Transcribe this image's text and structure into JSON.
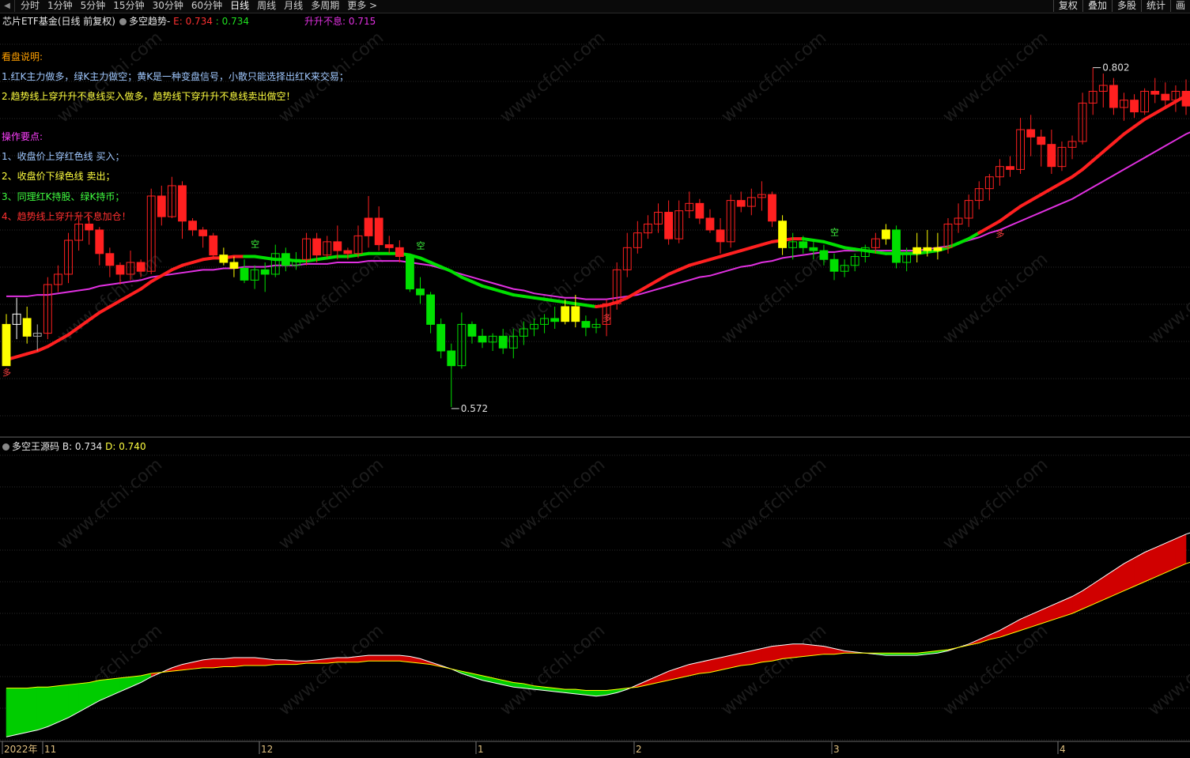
{
  "toolbar": {
    "periods": [
      "分时",
      "1分钟",
      "5分钟",
      "15分钟",
      "30分钟",
      "60分钟",
      "日线",
      "周线",
      "月线",
      "多周期",
      "更多 >"
    ],
    "active_period": "日线",
    "right_buttons": [
      "复权",
      "叠加",
      "多股",
      "统计",
      "画"
    ]
  },
  "main_panel": {
    "security": "芯片ETF基金(日线 前复权)",
    "indicator": "多空趋势-",
    "e_label": "E: 0.734",
    "e2_label": ": 0.734",
    "sheng_label": "升升不息: 0.715",
    "high_marker": "0.802",
    "low_marker": "0.572",
    "signal_duo": "多",
    "signal_kong": "空"
  },
  "notes": {
    "heading1": "看盘说明:",
    "line1": "1.红K主力做多，绿K主力做空；黄K是一种变盘信号，小散只能选择出红K来交易；",
    "line2": "2.趋势线上穿升升不息线买入做多，趋势线下穿升升不息线卖出做空！",
    "heading2": "操作要点:",
    "tip1": "1、收盘价上穿红色线 买入；",
    "tip2": "2、收盘价下绿色线 卖出；",
    "tip3": "3、同理红K持股、绿K持币；",
    "tip4": "4、趋势线上穿升升不息加仓！"
  },
  "sub_panel": {
    "name": "多空王源码",
    "b_label": "B: 0.734",
    "d_label": "D: 0.740"
  },
  "x_axis": {
    "labels": [
      "2022年",
      "11",
      "12",
      "1",
      "2",
      "3",
      "4"
    ]
  },
  "watermark": "www.cfchi.com",
  "colors": {
    "up": "#ff2020",
    "down": "#00e000",
    "yellow": "#ffff00",
    "trend_up": "#ff2020",
    "trend_down": "#00e000",
    "magenta": "#e030e0",
    "grid": "#333333",
    "background": "#000000"
  },
  "chart_data": {
    "type": "candlestick",
    "price_range": [
      0.55,
      0.82
    ],
    "osc_range": [
      0.5,
      1.0
    ],
    "candles": [
      [
        0.6,
        0.635,
        0.628,
        0.608,
        "y"
      ],
      [
        0.628,
        0.646,
        0.635,
        0.618,
        "w"
      ],
      [
        0.632,
        0.64,
        0.62,
        0.615,
        "y"
      ],
      [
        0.62,
        0.628,
        0.622,
        0.61,
        "n"
      ],
      [
        0.622,
        0.66,
        0.655,
        0.618,
        "u"
      ],
      [
        0.655,
        0.668,
        0.662,
        0.65,
        "u"
      ],
      [
        0.662,
        0.69,
        0.685,
        0.656,
        "u"
      ],
      [
        0.685,
        0.702,
        0.696,
        0.678,
        "u"
      ],
      [
        0.696,
        0.701,
        0.692,
        0.682,
        "d"
      ],
      [
        0.692,
        0.694,
        0.676,
        0.668,
        "r"
      ],
      [
        0.676,
        0.68,
        0.668,
        0.66,
        "r"
      ],
      [
        0.668,
        0.67,
        0.662,
        0.655,
        "d"
      ],
      [
        0.662,
        0.678,
        0.67,
        0.658,
        "u"
      ],
      [
        0.67,
        0.672,
        0.664,
        0.66,
        "d"
      ],
      [
        0.664,
        0.72,
        0.715,
        0.662,
        "u"
      ],
      [
        0.715,
        0.722,
        0.701,
        0.695,
        "r"
      ],
      [
        0.701,
        0.728,
        0.722,
        0.7,
        "u"
      ],
      [
        0.722,
        0.725,
        0.698,
        0.686,
        "r"
      ],
      [
        0.698,
        0.7,
        0.692,
        0.688,
        "r"
      ],
      [
        0.692,
        0.694,
        0.688,
        0.68,
        "r"
      ],
      [
        0.688,
        0.69,
        0.675,
        0.672,
        "r"
      ],
      [
        0.675,
        0.68,
        0.67,
        0.668,
        "y"
      ],
      [
        0.67,
        0.674,
        0.666,
        0.66,
        "y"
      ],
      [
        0.666,
        0.672,
        0.658,
        0.656,
        "g"
      ],
      [
        0.658,
        0.668,
        0.665,
        0.652,
        "gu"
      ],
      [
        0.665,
        0.67,
        0.662,
        0.65,
        "g"
      ],
      [
        0.662,
        0.682,
        0.676,
        0.66,
        "gu"
      ],
      [
        0.676,
        0.68,
        0.668,
        0.664,
        "g"
      ],
      [
        0.668,
        0.677,
        0.672,
        0.665,
        "gu"
      ],
      [
        0.672,
        0.69,
        0.686,
        0.668,
        "u"
      ],
      [
        0.686,
        0.69,
        0.675,
        0.67,
        "r"
      ],
      [
        0.675,
        0.688,
        0.684,
        0.673,
        "u"
      ],
      [
        0.684,
        0.695,
        0.678,
        0.672,
        "r"
      ],
      [
        0.678,
        0.68,
        0.676,
        0.672,
        "r"
      ],
      [
        0.676,
        0.695,
        0.688,
        0.673,
        "u"
      ],
      [
        0.688,
        0.715,
        0.7,
        0.68,
        "r"
      ],
      [
        0.7,
        0.708,
        0.682,
        0.678,
        "r"
      ],
      [
        0.682,
        0.688,
        0.68,
        0.676,
        "r"
      ],
      [
        0.68,
        0.685,
        0.674,
        0.67,
        "d"
      ],
      [
        0.674,
        0.676,
        0.652,
        0.65,
        "g"
      ],
      [
        0.652,
        0.66,
        0.648,
        0.642,
        "g"
      ],
      [
        0.648,
        0.65,
        0.628,
        0.622,
        "g"
      ],
      [
        0.628,
        0.632,
        0.61,
        0.605,
        "g"
      ],
      [
        0.61,
        0.615,
        0.6,
        0.572,
        "g"
      ],
      [
        0.6,
        0.636,
        0.628,
        0.598,
        "gu"
      ],
      [
        0.628,
        0.63,
        0.62,
        0.615,
        "g"
      ],
      [
        0.62,
        0.625,
        0.616,
        0.612,
        "g"
      ],
      [
        0.616,
        0.622,
        0.62,
        0.61,
        "gu"
      ],
      [
        0.62,
        0.625,
        0.612,
        0.608,
        "g"
      ],
      [
        0.612,
        0.625,
        0.62,
        0.605,
        "gu"
      ],
      [
        0.62,
        0.63,
        0.625,
        0.614,
        "gu"
      ],
      [
        0.625,
        0.632,
        0.628,
        0.62,
        "gu"
      ],
      [
        0.628,
        0.635,
        0.632,
        0.622,
        "gu"
      ],
      [
        0.632,
        0.64,
        0.63,
        0.625,
        "g"
      ],
      [
        0.63,
        0.645,
        0.64,
        0.628,
        "y"
      ],
      [
        0.64,
        0.648,
        0.63,
        0.626,
        "y"
      ],
      [
        0.63,
        0.634,
        0.626,
        0.62,
        "g"
      ],
      [
        0.626,
        0.632,
        0.628,
        0.622,
        "gu"
      ],
      [
        0.628,
        0.645,
        0.642,
        0.62,
        "u"
      ],
      [
        0.642,
        0.67,
        0.665,
        0.638,
        "u"
      ],
      [
        0.665,
        0.69,
        0.68,
        0.66,
        "u"
      ],
      [
        0.68,
        0.698,
        0.69,
        0.676,
        "u"
      ],
      [
        0.69,
        0.702,
        0.696,
        0.686,
        "u"
      ],
      [
        0.696,
        0.71,
        0.704,
        0.69,
        "u"
      ],
      [
        0.704,
        0.712,
        0.686,
        0.682,
        "r"
      ],
      [
        0.686,
        0.712,
        0.705,
        0.683,
        "u"
      ],
      [
        0.705,
        0.718,
        0.71,
        0.7,
        "u"
      ],
      [
        0.71,
        0.713,
        0.7,
        0.696,
        "r"
      ],
      [
        0.7,
        0.706,
        0.692,
        0.69,
        "r"
      ],
      [
        0.692,
        0.7,
        0.684,
        0.676,
        "r"
      ],
      [
        0.684,
        0.716,
        0.712,
        0.68,
        "u"
      ],
      [
        0.712,
        0.718,
        0.708,
        0.704,
        "r"
      ],
      [
        0.708,
        0.72,
        0.714,
        0.702,
        "u"
      ],
      [
        0.714,
        0.725,
        0.716,
        0.705,
        "u"
      ],
      [
        0.716,
        0.718,
        0.698,
        0.694,
        "r"
      ],
      [
        0.698,
        0.702,
        0.68,
        0.675,
        "y"
      ],
      [
        0.68,
        0.69,
        0.684,
        0.672,
        "gu"
      ],
      [
        0.684,
        0.688,
        0.68,
        0.676,
        "g"
      ],
      [
        0.68,
        0.685,
        0.678,
        0.672,
        "g"
      ],
      [
        0.678,
        0.682,
        0.672,
        0.668,
        "g"
      ],
      [
        0.672,
        0.676,
        0.664,
        0.658,
        "g"
      ],
      [
        0.664,
        0.672,
        0.668,
        0.66,
        "gu"
      ],
      [
        0.668,
        0.676,
        0.674,
        0.664,
        "gu"
      ],
      [
        0.674,
        0.682,
        0.68,
        0.67,
        "gu"
      ],
      [
        0.68,
        0.69,
        0.686,
        0.676,
        "u"
      ],
      [
        0.686,
        0.696,
        0.692,
        0.682,
        "y"
      ],
      [
        0.692,
        0.695,
        0.67,
        0.666,
        "g"
      ],
      [
        0.67,
        0.68,
        0.676,
        0.664,
        "gu"
      ],
      [
        0.676,
        0.69,
        0.68,
        0.67,
        "y"
      ],
      [
        0.68,
        0.692,
        0.678,
        0.674,
        "y"
      ],
      [
        0.678,
        0.69,
        0.68,
        0.672,
        "y"
      ],
      [
        0.68,
        0.7,
        0.696,
        0.676,
        "u"
      ],
      [
        0.696,
        0.71,
        0.7,
        0.69,
        "u"
      ],
      [
        0.7,
        0.716,
        0.712,
        0.694,
        "u"
      ],
      [
        0.712,
        0.725,
        0.72,
        0.706,
        "u"
      ],
      [
        0.72,
        0.73,
        0.728,
        0.712,
        "u"
      ],
      [
        0.728,
        0.74,
        0.735,
        0.722,
        "u"
      ],
      [
        0.735,
        0.742,
        0.733,
        0.728,
        "r"
      ],
      [
        0.733,
        0.768,
        0.76,
        0.73,
        "u"
      ],
      [
        0.76,
        0.77,
        0.755,
        0.742,
        "r"
      ],
      [
        0.755,
        0.76,
        0.75,
        0.735,
        "r"
      ],
      [
        0.75,
        0.76,
        0.735,
        0.73,
        "r"
      ],
      [
        0.735,
        0.752,
        0.748,
        0.732,
        "u"
      ],
      [
        0.748,
        0.756,
        0.752,
        0.74,
        "u"
      ],
      [
        0.752,
        0.785,
        0.778,
        0.75,
        "u"
      ],
      [
        0.778,
        0.802,
        0.786,
        0.77,
        "u"
      ],
      [
        0.786,
        0.798,
        0.79,
        0.775,
        "u"
      ],
      [
        0.79,
        0.795,
        0.775,
        0.77,
        "r"
      ],
      [
        0.775,
        0.785,
        0.78,
        0.766,
        "u"
      ],
      [
        0.78,
        0.784,
        0.772,
        0.768,
        "r"
      ],
      [
        0.772,
        0.788,
        0.786,
        0.77,
        "u"
      ],
      [
        0.786,
        0.795,
        0.784,
        0.778,
        "r"
      ],
      [
        0.784,
        0.792,
        0.78,
        0.776,
        "r"
      ],
      [
        0.78,
        0.79,
        0.786,
        0.772,
        "u"
      ],
      [
        0.786,
        0.794,
        0.776,
        0.77,
        "r"
      ]
    ],
    "trend_line": [
      0.604,
      0.606,
      0.608,
      0.61,
      0.613,
      0.617,
      0.621,
      0.626,
      0.631,
      0.636,
      0.64,
      0.644,
      0.648,
      0.652,
      0.657,
      0.661,
      0.665,
      0.668,
      0.67,
      0.672,
      0.673,
      0.673,
      0.674,
      0.674,
      0.674,
      0.673,
      0.672,
      0.672,
      0.671,
      0.671,
      0.672,
      0.673,
      0.674,
      0.674,
      0.675,
      0.676,
      0.676,
      0.676,
      0.676,
      0.675,
      0.673,
      0.67,
      0.667,
      0.664,
      0.66,
      0.657,
      0.654,
      0.652,
      0.65,
      0.648,
      0.647,
      0.646,
      0.645,
      0.644,
      0.643,
      0.642,
      0.641,
      0.64,
      0.641,
      0.643,
      0.646,
      0.65,
      0.654,
      0.658,
      0.662,
      0.665,
      0.668,
      0.67,
      0.672,
      0.674,
      0.676,
      0.678,
      0.68,
      0.682,
      0.684,
      0.685,
      0.686,
      0.686,
      0.685,
      0.684,
      0.682,
      0.68,
      0.679,
      0.678,
      0.677,
      0.676,
      0.676,
      0.676,
      0.676,
      0.677,
      0.678,
      0.68,
      0.683,
      0.686,
      0.69,
      0.694,
      0.698,
      0.703,
      0.708,
      0.712,
      0.716,
      0.72,
      0.724,
      0.728,
      0.733,
      0.739,
      0.745,
      0.751,
      0.757,
      0.762,
      0.767,
      0.771,
      0.775,
      0.779,
      0.783,
      0.786
    ],
    "sheng_line": [
      0.647,
      0.647,
      0.647,
      0.648,
      0.648,
      0.649,
      0.65,
      0.651,
      0.652,
      0.654,
      0.655,
      0.656,
      0.657,
      0.658,
      0.66,
      0.661,
      0.662,
      0.663,
      0.664,
      0.665,
      0.665,
      0.666,
      0.666,
      0.667,
      0.667,
      0.667,
      0.668,
      0.668,
      0.668,
      0.669,
      0.669,
      0.669,
      0.67,
      0.67,
      0.67,
      0.671,
      0.671,
      0.671,
      0.671,
      0.67,
      0.669,
      0.668,
      0.666,
      0.664,
      0.662,
      0.66,
      0.658,
      0.656,
      0.654,
      0.652,
      0.651,
      0.649,
      0.648,
      0.647,
      0.646,
      0.646,
      0.645,
      0.645,
      0.645,
      0.646,
      0.647,
      0.648,
      0.65,
      0.652,
      0.654,
      0.656,
      0.658,
      0.66,
      0.661,
      0.663,
      0.665,
      0.667,
      0.668,
      0.67,
      0.671,
      0.673,
      0.674,
      0.675,
      0.676,
      0.677,
      0.677,
      0.678,
      0.678,
      0.678,
      0.678,
      0.678,
      0.678,
      0.678,
      0.678,
      0.679,
      0.68,
      0.681,
      0.683,
      0.685,
      0.687,
      0.69,
      0.692,
      0.695,
      0.698,
      0.701,
      0.704,
      0.707,
      0.71,
      0.713,
      0.717,
      0.721,
      0.725,
      0.729,
      0.733,
      0.737,
      0.741,
      0.745,
      0.749,
      0.753,
      0.757,
      0.76
    ]
  }
}
